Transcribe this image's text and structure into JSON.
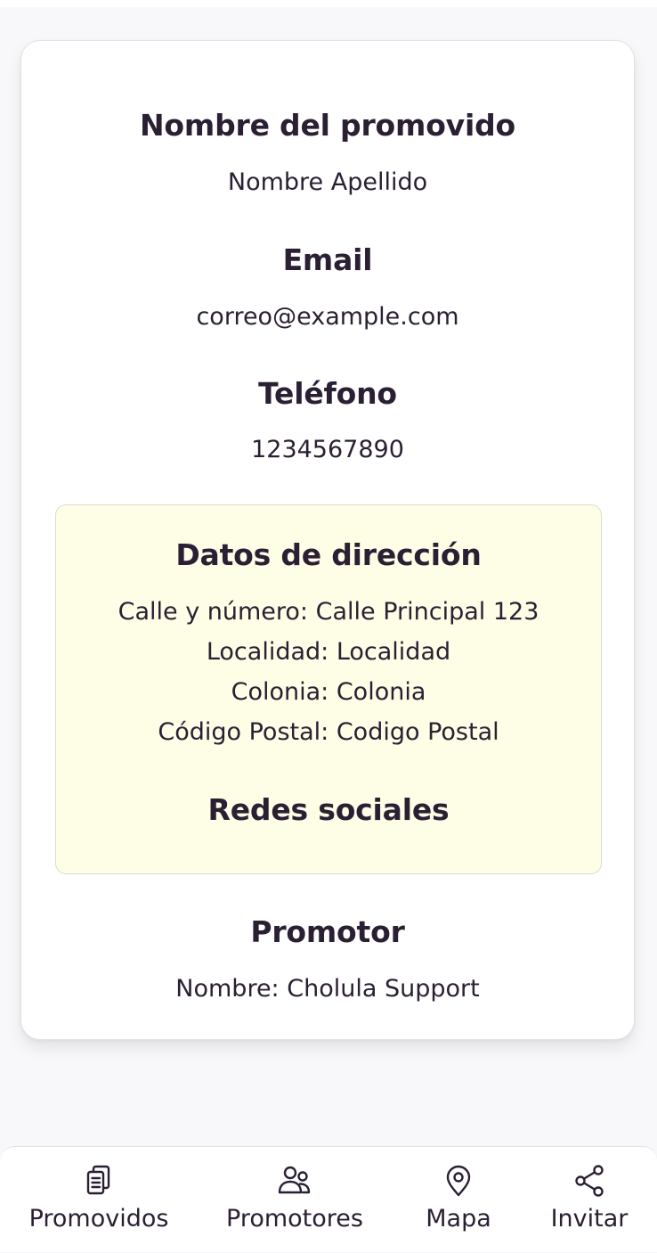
{
  "profile": {
    "name_heading": "Nombre del promovido",
    "name_value": "Nombre Apellido",
    "email_heading": "Email",
    "email_value": "correo@example.com",
    "phone_heading": "Teléfono",
    "phone_value": "1234567890"
  },
  "address": {
    "heading": "Datos de dirección",
    "street": "Calle y número: Calle Principal 123",
    "locality": "Localidad: Localidad",
    "colony": "Colonia: Colonia",
    "postal_code": "Código Postal: Codigo Postal",
    "social_heading": "Redes sociales"
  },
  "promoter": {
    "heading": "Promotor",
    "name": "Nombre: Cholula Support"
  },
  "nav": {
    "items": [
      {
        "label": "Promovidos",
        "icon": "clipboard-list-icon"
      },
      {
        "label": "Promotores",
        "icon": "users-icon"
      },
      {
        "label": "Mapa",
        "icon": "map-pin-icon"
      },
      {
        "label": "Invitar",
        "icon": "share-icon"
      }
    ]
  },
  "colors": {
    "text": "#2a1f33",
    "address_bg": "#fefde5",
    "card_bg": "#ffffff",
    "page_bg": "#f8f8fa"
  }
}
